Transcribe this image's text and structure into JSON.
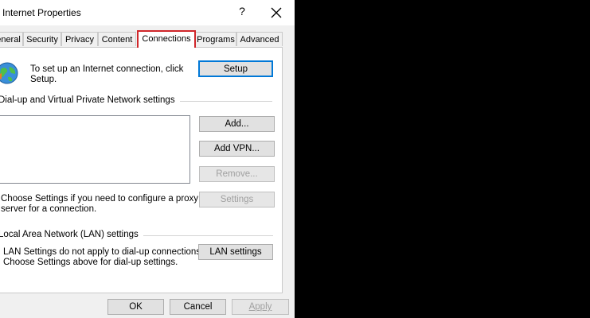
{
  "window": {
    "title": "Internet Properties",
    "help_glyph": "?"
  },
  "tabs": [
    {
      "label": "eneral"
    },
    {
      "label": "Security"
    },
    {
      "label": "Privacy"
    },
    {
      "label": "Content"
    },
    {
      "label": "Connections"
    },
    {
      "label": "Programs"
    },
    {
      "label": "Advanced"
    }
  ],
  "active_tab": "Connections",
  "setup": {
    "text_line1": "To set up an Internet connection, click",
    "text_line2": "Setup.",
    "button": "Setup"
  },
  "dialup": {
    "group_title": "Dial-up and Virtual Private Network settings",
    "add_button": "Add...",
    "add_vpn_button": "Add VPN...",
    "remove_button": "Remove...",
    "settings_button": "Settings",
    "help_line1": "Choose Settings if you need to configure a proxy",
    "help_line2": "server for a connection."
  },
  "lan": {
    "group_title": "Local Area Network (LAN) settings",
    "text_line1": "LAN Settings do not apply to dial-up connections.",
    "text_line2": "Choose Settings above for dial-up settings.",
    "button": "LAN settings"
  },
  "footer": {
    "ok": "OK",
    "cancel": "Cancel",
    "apply": "Apply"
  },
  "colors": {
    "highlight": "#d0262a",
    "default_button_border": "#0078d7"
  }
}
